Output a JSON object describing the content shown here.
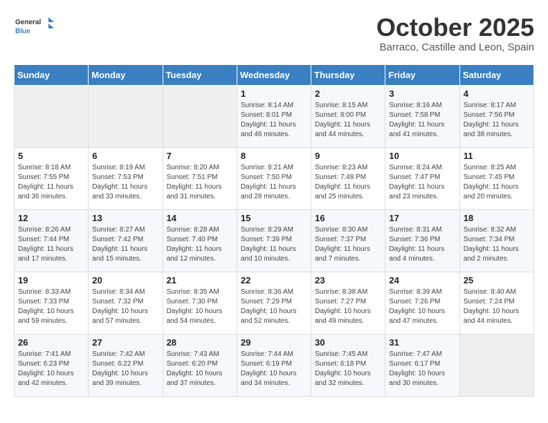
{
  "header": {
    "logo_general": "General",
    "logo_blue": "Blue",
    "month_title": "October 2025",
    "subtitle": "Barraco, Castille and Leon, Spain"
  },
  "days_of_week": [
    "Sunday",
    "Monday",
    "Tuesday",
    "Wednesday",
    "Thursday",
    "Friday",
    "Saturday"
  ],
  "weeks": [
    [
      {
        "day": "",
        "sunrise": "",
        "sunset": "",
        "daylight": ""
      },
      {
        "day": "",
        "sunrise": "",
        "sunset": "",
        "daylight": ""
      },
      {
        "day": "",
        "sunrise": "",
        "sunset": "",
        "daylight": ""
      },
      {
        "day": "1",
        "sunrise": "Sunrise: 8:14 AM",
        "sunset": "Sunset: 8:01 PM",
        "daylight": "Daylight: 11 hours and 46 minutes."
      },
      {
        "day": "2",
        "sunrise": "Sunrise: 8:15 AM",
        "sunset": "Sunset: 8:00 PM",
        "daylight": "Daylight: 11 hours and 44 minutes."
      },
      {
        "day": "3",
        "sunrise": "Sunrise: 8:16 AM",
        "sunset": "Sunset: 7:58 PM",
        "daylight": "Daylight: 11 hours and 41 minutes."
      },
      {
        "day": "4",
        "sunrise": "Sunrise: 8:17 AM",
        "sunset": "Sunset: 7:56 PM",
        "daylight": "Daylight: 11 hours and 38 minutes."
      }
    ],
    [
      {
        "day": "5",
        "sunrise": "Sunrise: 8:18 AM",
        "sunset": "Sunset: 7:55 PM",
        "daylight": "Daylight: 11 hours and 36 minutes."
      },
      {
        "day": "6",
        "sunrise": "Sunrise: 8:19 AM",
        "sunset": "Sunset: 7:53 PM",
        "daylight": "Daylight: 11 hours and 33 minutes."
      },
      {
        "day": "7",
        "sunrise": "Sunrise: 8:20 AM",
        "sunset": "Sunset: 7:51 PM",
        "daylight": "Daylight: 11 hours and 31 minutes."
      },
      {
        "day": "8",
        "sunrise": "Sunrise: 8:21 AM",
        "sunset": "Sunset: 7:50 PM",
        "daylight": "Daylight: 11 hours and 28 minutes."
      },
      {
        "day": "9",
        "sunrise": "Sunrise: 8:23 AM",
        "sunset": "Sunset: 7:48 PM",
        "daylight": "Daylight: 11 hours and 25 minutes."
      },
      {
        "day": "10",
        "sunrise": "Sunrise: 8:24 AM",
        "sunset": "Sunset: 7:47 PM",
        "daylight": "Daylight: 11 hours and 23 minutes."
      },
      {
        "day": "11",
        "sunrise": "Sunrise: 8:25 AM",
        "sunset": "Sunset: 7:45 PM",
        "daylight": "Daylight: 11 hours and 20 minutes."
      }
    ],
    [
      {
        "day": "12",
        "sunrise": "Sunrise: 8:26 AM",
        "sunset": "Sunset: 7:44 PM",
        "daylight": "Daylight: 11 hours and 17 minutes."
      },
      {
        "day": "13",
        "sunrise": "Sunrise: 8:27 AM",
        "sunset": "Sunset: 7:42 PM",
        "daylight": "Daylight: 11 hours and 15 minutes."
      },
      {
        "day": "14",
        "sunrise": "Sunrise: 8:28 AM",
        "sunset": "Sunset: 7:40 PM",
        "daylight": "Daylight: 11 hours and 12 minutes."
      },
      {
        "day": "15",
        "sunrise": "Sunrise: 8:29 AM",
        "sunset": "Sunset: 7:39 PM",
        "daylight": "Daylight: 11 hours and 10 minutes."
      },
      {
        "day": "16",
        "sunrise": "Sunrise: 8:30 AM",
        "sunset": "Sunset: 7:37 PM",
        "daylight": "Daylight: 11 hours and 7 minutes."
      },
      {
        "day": "17",
        "sunrise": "Sunrise: 8:31 AM",
        "sunset": "Sunset: 7:36 PM",
        "daylight": "Daylight: 11 hours and 4 minutes."
      },
      {
        "day": "18",
        "sunrise": "Sunrise: 8:32 AM",
        "sunset": "Sunset: 7:34 PM",
        "daylight": "Daylight: 11 hours and 2 minutes."
      }
    ],
    [
      {
        "day": "19",
        "sunrise": "Sunrise: 8:33 AM",
        "sunset": "Sunset: 7:33 PM",
        "daylight": "Daylight: 10 hours and 59 minutes."
      },
      {
        "day": "20",
        "sunrise": "Sunrise: 8:34 AM",
        "sunset": "Sunset: 7:32 PM",
        "daylight": "Daylight: 10 hours and 57 minutes."
      },
      {
        "day": "21",
        "sunrise": "Sunrise: 8:35 AM",
        "sunset": "Sunset: 7:30 PM",
        "daylight": "Daylight: 10 hours and 54 minutes."
      },
      {
        "day": "22",
        "sunrise": "Sunrise: 8:36 AM",
        "sunset": "Sunset: 7:29 PM",
        "daylight": "Daylight: 10 hours and 52 minutes."
      },
      {
        "day": "23",
        "sunrise": "Sunrise: 8:38 AM",
        "sunset": "Sunset: 7:27 PM",
        "daylight": "Daylight: 10 hours and 49 minutes."
      },
      {
        "day": "24",
        "sunrise": "Sunrise: 8:39 AM",
        "sunset": "Sunset: 7:26 PM",
        "daylight": "Daylight: 10 hours and 47 minutes."
      },
      {
        "day": "25",
        "sunrise": "Sunrise: 8:40 AM",
        "sunset": "Sunset: 7:24 PM",
        "daylight": "Daylight: 10 hours and 44 minutes."
      }
    ],
    [
      {
        "day": "26",
        "sunrise": "Sunrise: 7:41 AM",
        "sunset": "Sunset: 6:23 PM",
        "daylight": "Daylight: 10 hours and 42 minutes."
      },
      {
        "day": "27",
        "sunrise": "Sunrise: 7:42 AM",
        "sunset": "Sunset: 6:22 PM",
        "daylight": "Daylight: 10 hours and 39 minutes."
      },
      {
        "day": "28",
        "sunrise": "Sunrise: 7:43 AM",
        "sunset": "Sunset: 6:20 PM",
        "daylight": "Daylight: 10 hours and 37 minutes."
      },
      {
        "day": "29",
        "sunrise": "Sunrise: 7:44 AM",
        "sunset": "Sunset: 6:19 PM",
        "daylight": "Daylight: 10 hours and 34 minutes."
      },
      {
        "day": "30",
        "sunrise": "Sunrise: 7:45 AM",
        "sunset": "Sunset: 6:18 PM",
        "daylight": "Daylight: 10 hours and 32 minutes."
      },
      {
        "day": "31",
        "sunrise": "Sunrise: 7:47 AM",
        "sunset": "Sunset: 6:17 PM",
        "daylight": "Daylight: 10 hours and 30 minutes."
      },
      {
        "day": "",
        "sunrise": "",
        "sunset": "",
        "daylight": ""
      }
    ]
  ]
}
